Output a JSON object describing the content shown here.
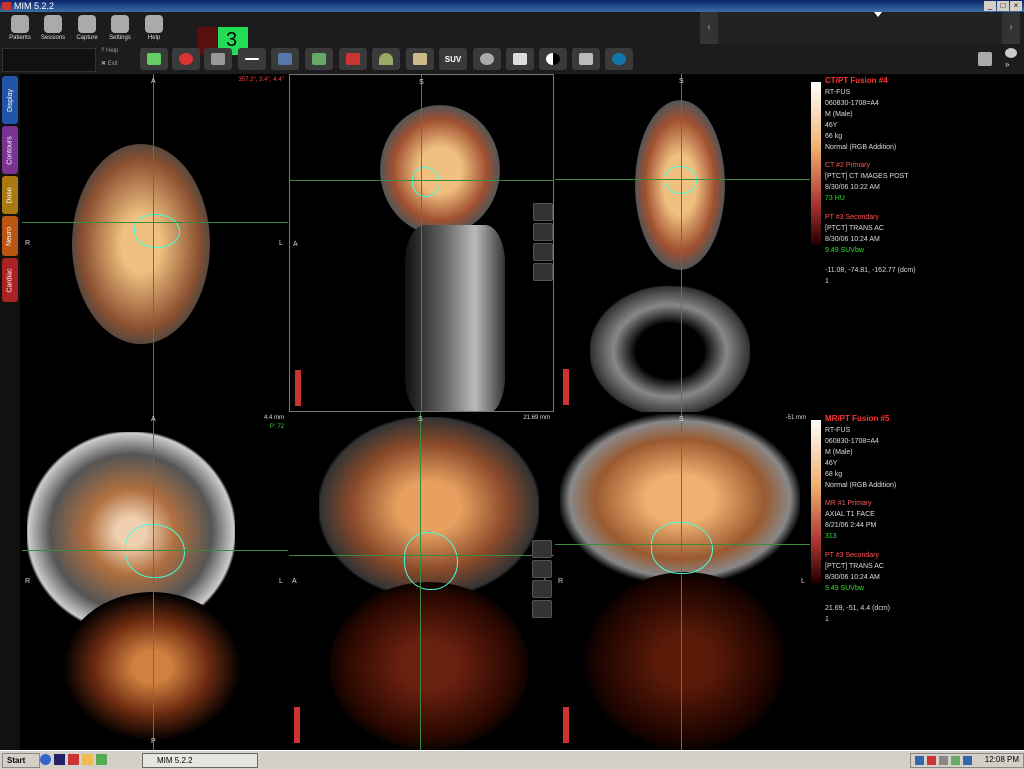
{
  "window": {
    "title": "MIM 5.2.2"
  },
  "toolbar": {
    "buttons": [
      {
        "label": "Patients"
      },
      {
        "label": "Sessions"
      },
      {
        "label": "Capture"
      },
      {
        "label": "Settings"
      },
      {
        "label": "Help"
      }
    ],
    "small_help": "? Help",
    "small_exit": "✖ Exit",
    "layout_number": "3",
    "suv_label": "SUV"
  },
  "sidetabs": [
    {
      "label": "Display",
      "color": "#2255aa"
    },
    {
      "label": "Contours",
      "color": "#7a3390"
    },
    {
      "label": "Dose",
      "color": "#aa7a10"
    },
    {
      "label": "Neuro",
      "color": "#bb5511"
    },
    {
      "label": "Cardiac",
      "color": "#aa2222"
    }
  ],
  "top_row": {
    "axial": {
      "top": "A",
      "left": "R",
      "right": "L",
      "readout": "357.2°, 3.4°, 4.4°"
    },
    "sagittal": {
      "top": "S",
      "left": "A"
    },
    "coronal": {
      "top": "S"
    }
  },
  "bottom_row": {
    "axial": {
      "top": "A",
      "bottom": "P",
      "left": "R",
      "right": "L",
      "slice": "4.4 mm",
      "pos": "P: 72"
    },
    "sagittal": {
      "top": "S",
      "left": "A",
      "right": "L",
      "slice": "21.69 mm"
    },
    "coronal": {
      "top": "S",
      "left": "R",
      "right": "L",
      "slice": "-51 mm"
    }
  },
  "panel_top": {
    "title": "CT/PT Fusion #4",
    "lines": [
      "RT-FUS",
      "060830-1708=A4",
      "M (Male)",
      "46Y",
      "66 kg",
      "Normal (RGB Addition)"
    ],
    "primary_title": "CT #2 Primary",
    "primary": [
      "[PTCT] CT IMAGES POST",
      "8/30/06 10:22 AM"
    ],
    "primary_value": "73 HU",
    "secondary_title": "PT #3 Secondary",
    "secondary": [
      "[PTCT] TRANS AC",
      "8/30/06 10:24 AM"
    ],
    "secondary_value": "9.49 SUVbw",
    "coords": "-11.08, -74.81, -162.77 (dcm)",
    "scale_low": "1"
  },
  "panel_bottom": {
    "title": "MR/PT Fusion #5",
    "lines": [
      "RT-FUS",
      "060830-1708=A4",
      "M (Male)",
      "46Y",
      "68 kg",
      "Normal (RGB Addition)"
    ],
    "primary_title": "MR #1 Primary",
    "primary": [
      "AXIAL T1 FACE",
      "8/21/06 2:44 PM"
    ],
    "primary_value": "313",
    "secondary_title": "PT #3 Secondary",
    "secondary": [
      "[PTCT] TRANS AC",
      "8/30/06 10:24 AM"
    ],
    "secondary_value": "9.49 SUVbw",
    "coords": "21.69, -51, 4.4 (dcm)",
    "scale_low": "1"
  },
  "taskbar": {
    "start": "Start",
    "task": "MIM 5.2.2",
    "clock": "12:08 PM"
  },
  "colors": {
    "crosshair": "#3c8a3c",
    "contour": "#44ddcc",
    "title_red": "#ff3333",
    "sub_red": "#ff5555",
    "value_green": "#33dd33"
  }
}
